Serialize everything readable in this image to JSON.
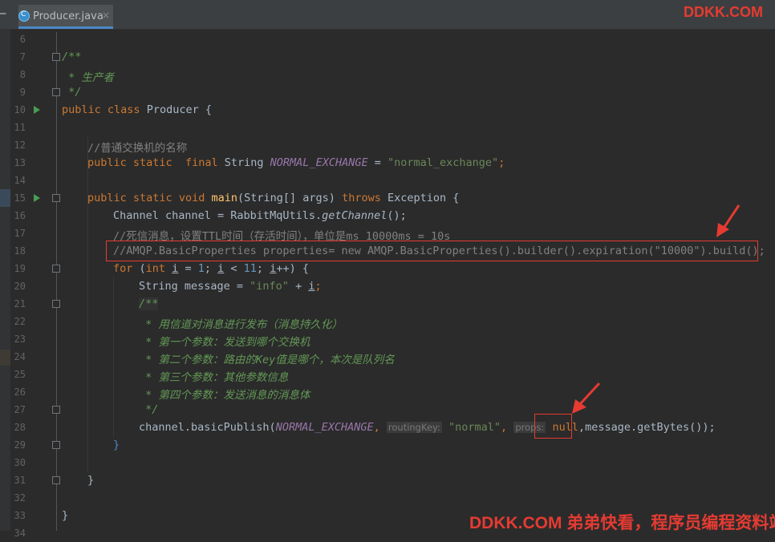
{
  "tab": {
    "filename": "Producer.java",
    "icon": "java-class-icon",
    "close": "×"
  },
  "watermark": {
    "top": "DDKK.COM",
    "bottom": "DDKK.COM 弟弟快看，程序员编程资料站",
    "color": "#e53b32"
  },
  "colors": {
    "background": "#2b2b2b",
    "keyword": "#cc7832",
    "string": "#6a8759",
    "number": "#6897bb",
    "comment": "#808080",
    "doc_comment": "#629755",
    "field": "#9876aa",
    "text": "#a9b7c6",
    "highlight_box": "#e53b32"
  },
  "lines": [
    {
      "n": "6"
    },
    {
      "n": "7",
      "t": {
        "a": "/**"
      }
    },
    {
      "n": "8",
      "t": {
        "a": " * 生产者"
      }
    },
    {
      "n": "9",
      "t": {
        "a": " */"
      }
    },
    {
      "n": "10",
      "t": {
        "kw1": "public",
        "kw2": "class",
        "name": "Producer",
        "brace": "{"
      }
    },
    {
      "n": "11"
    },
    {
      "n": "12",
      "t": {
        "a": "//普通交换机的名称"
      }
    },
    {
      "n": "13",
      "t": {
        "kw1": "public",
        "kw2": "static",
        "kw3": "final",
        "type": "String",
        "field": "NORMAL_EXCHANGE",
        "eq": "=",
        "str": "\"normal_exchange\"",
        "semi": ";"
      }
    },
    {
      "n": "14"
    },
    {
      "n": "15",
      "t": {
        "kw1": "public",
        "kw2": "static",
        "kw3": "void",
        "method": "main",
        "params": "(String[] args)",
        "kw4": "throws",
        "exc": "Exception",
        "brace": "{"
      }
    },
    {
      "n": "16",
      "t": {
        "a": "Channel channel = RabbitMqUtils.",
        "m": "getChannel",
        "b": "();"
      }
    },
    {
      "n": "17",
      "t": {
        "a": "//死信消息，设置TTL时间（存活时间），单位是ms 10000ms = 10s"
      }
    },
    {
      "n": "18",
      "t": {
        "a": "//AMQP.BasicProperties properties= new AMQP.BasicProperties().builder().expiration(\"10000\").build();"
      }
    },
    {
      "n": "19",
      "t": {
        "kw": "for",
        "p1": " (",
        "kw2": "int",
        "v1": "i",
        "p2": " = ",
        "n1": "1",
        "p3": "; ",
        "v2": "i",
        "p4": " < ",
        "n2": "11",
        "p5": "; ",
        "v3": "i",
        "p6": "++) {"
      }
    },
    {
      "n": "20",
      "t": {
        "a": "String message = ",
        "str": "\"info\"",
        "b": " + ",
        "v": "i",
        "c": ";"
      }
    },
    {
      "n": "21",
      "t": {
        "a": "/**"
      }
    },
    {
      "n": "22",
      "t": {
        "a": " * 用信道对消息进行发布（消息持久化）"
      }
    },
    {
      "n": "23",
      "t": {
        "a": " * 第一个参数：发送到哪个交换机"
      }
    },
    {
      "n": "24",
      "t": {
        "a": " * 第二个参数：路由的Key值是哪个，本次是队列名"
      }
    },
    {
      "n": "25",
      "t": {
        "a": " * 第三个参数：其他参数信息"
      }
    },
    {
      "n": "26",
      "t": {
        "a": " * 第四个参数：发送消息的消息体"
      }
    },
    {
      "n": "27",
      "t": {
        "a": " */"
      }
    },
    {
      "n": "28",
      "t": {
        "a": "channel.basicPublish(",
        "field": "NORMAL_EXCHANGE",
        "c1": ",",
        "hint1": "routingKey:",
        "str": "\"normal\"",
        "c2": ",",
        "hint2": "props:",
        "kw": "null",
        "rest": ",message.getBytes());"
      }
    },
    {
      "n": "29",
      "t": {
        "a": "}"
      }
    },
    {
      "n": "30"
    },
    {
      "n": "31",
      "t": {
        "a": "}"
      }
    },
    {
      "n": "32"
    },
    {
      "n": "33",
      "t": {
        "a": "}"
      }
    },
    {
      "n": "34"
    }
  ]
}
